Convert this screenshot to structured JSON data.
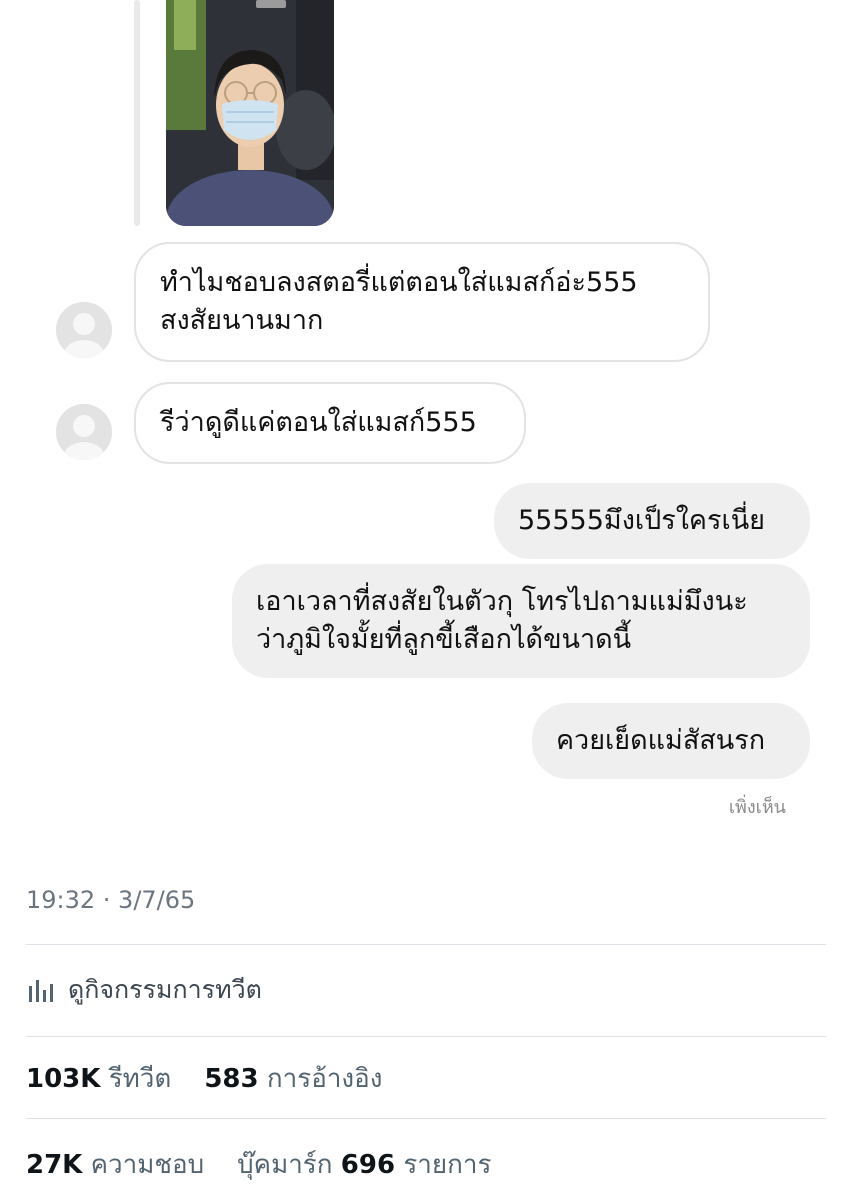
{
  "messages": [
    {
      "direction": "incoming",
      "text_lines": [
        "ทำไมชอบลงสตอรี่แต่ตอนใส่แมสก์อ่ะ555",
        "สงสัยนานมาก"
      ]
    },
    {
      "direction": "incoming",
      "text_lines": [
        "รีว่าดูดีแค่ตอนใส่แมสก์555"
      ]
    },
    {
      "direction": "outgoing",
      "text_lines": [
        "55555มึงเป็รใครเนี่ย"
      ]
    },
    {
      "direction": "outgoing",
      "text_lines": [
        "เอาเวลาที่สงสัยในตัวกุ โทรไปถามแม่มึงนะ",
        "ว่าภูมิใจมั้ยที่ลูกขี้เสือกได้ขนาดนี้"
      ]
    },
    {
      "direction": "outgoing",
      "text_lines": [
        "ควยเย็ดแม่สัสนรก"
      ]
    }
  ],
  "seen_label": "เพิ่งเห็น",
  "tweet": {
    "timestamp": "19:32 · 3/7/65",
    "activity_label": "ดูกิจกรรมการทวีต",
    "retweets_count": "103K",
    "retweets_label": "รีทวีต",
    "quotes_count": "583",
    "quotes_label": "การอ้างอิง",
    "likes_count": "27K",
    "likes_label": "ความชอบ",
    "bookmarks_label": "บุ๊คมาร์ก",
    "bookmarks_count": "696",
    "bookmarks_unit": "รายการ"
  },
  "icons": {
    "story": "story-photo-thumbnail",
    "avatar": "default-avatar-icon",
    "activity": "bar-chart-icon"
  },
  "colors": {
    "incoming_border": "#e3e3e3",
    "outgoing_bg": "#efefef",
    "muted_text": "#536471"
  }
}
